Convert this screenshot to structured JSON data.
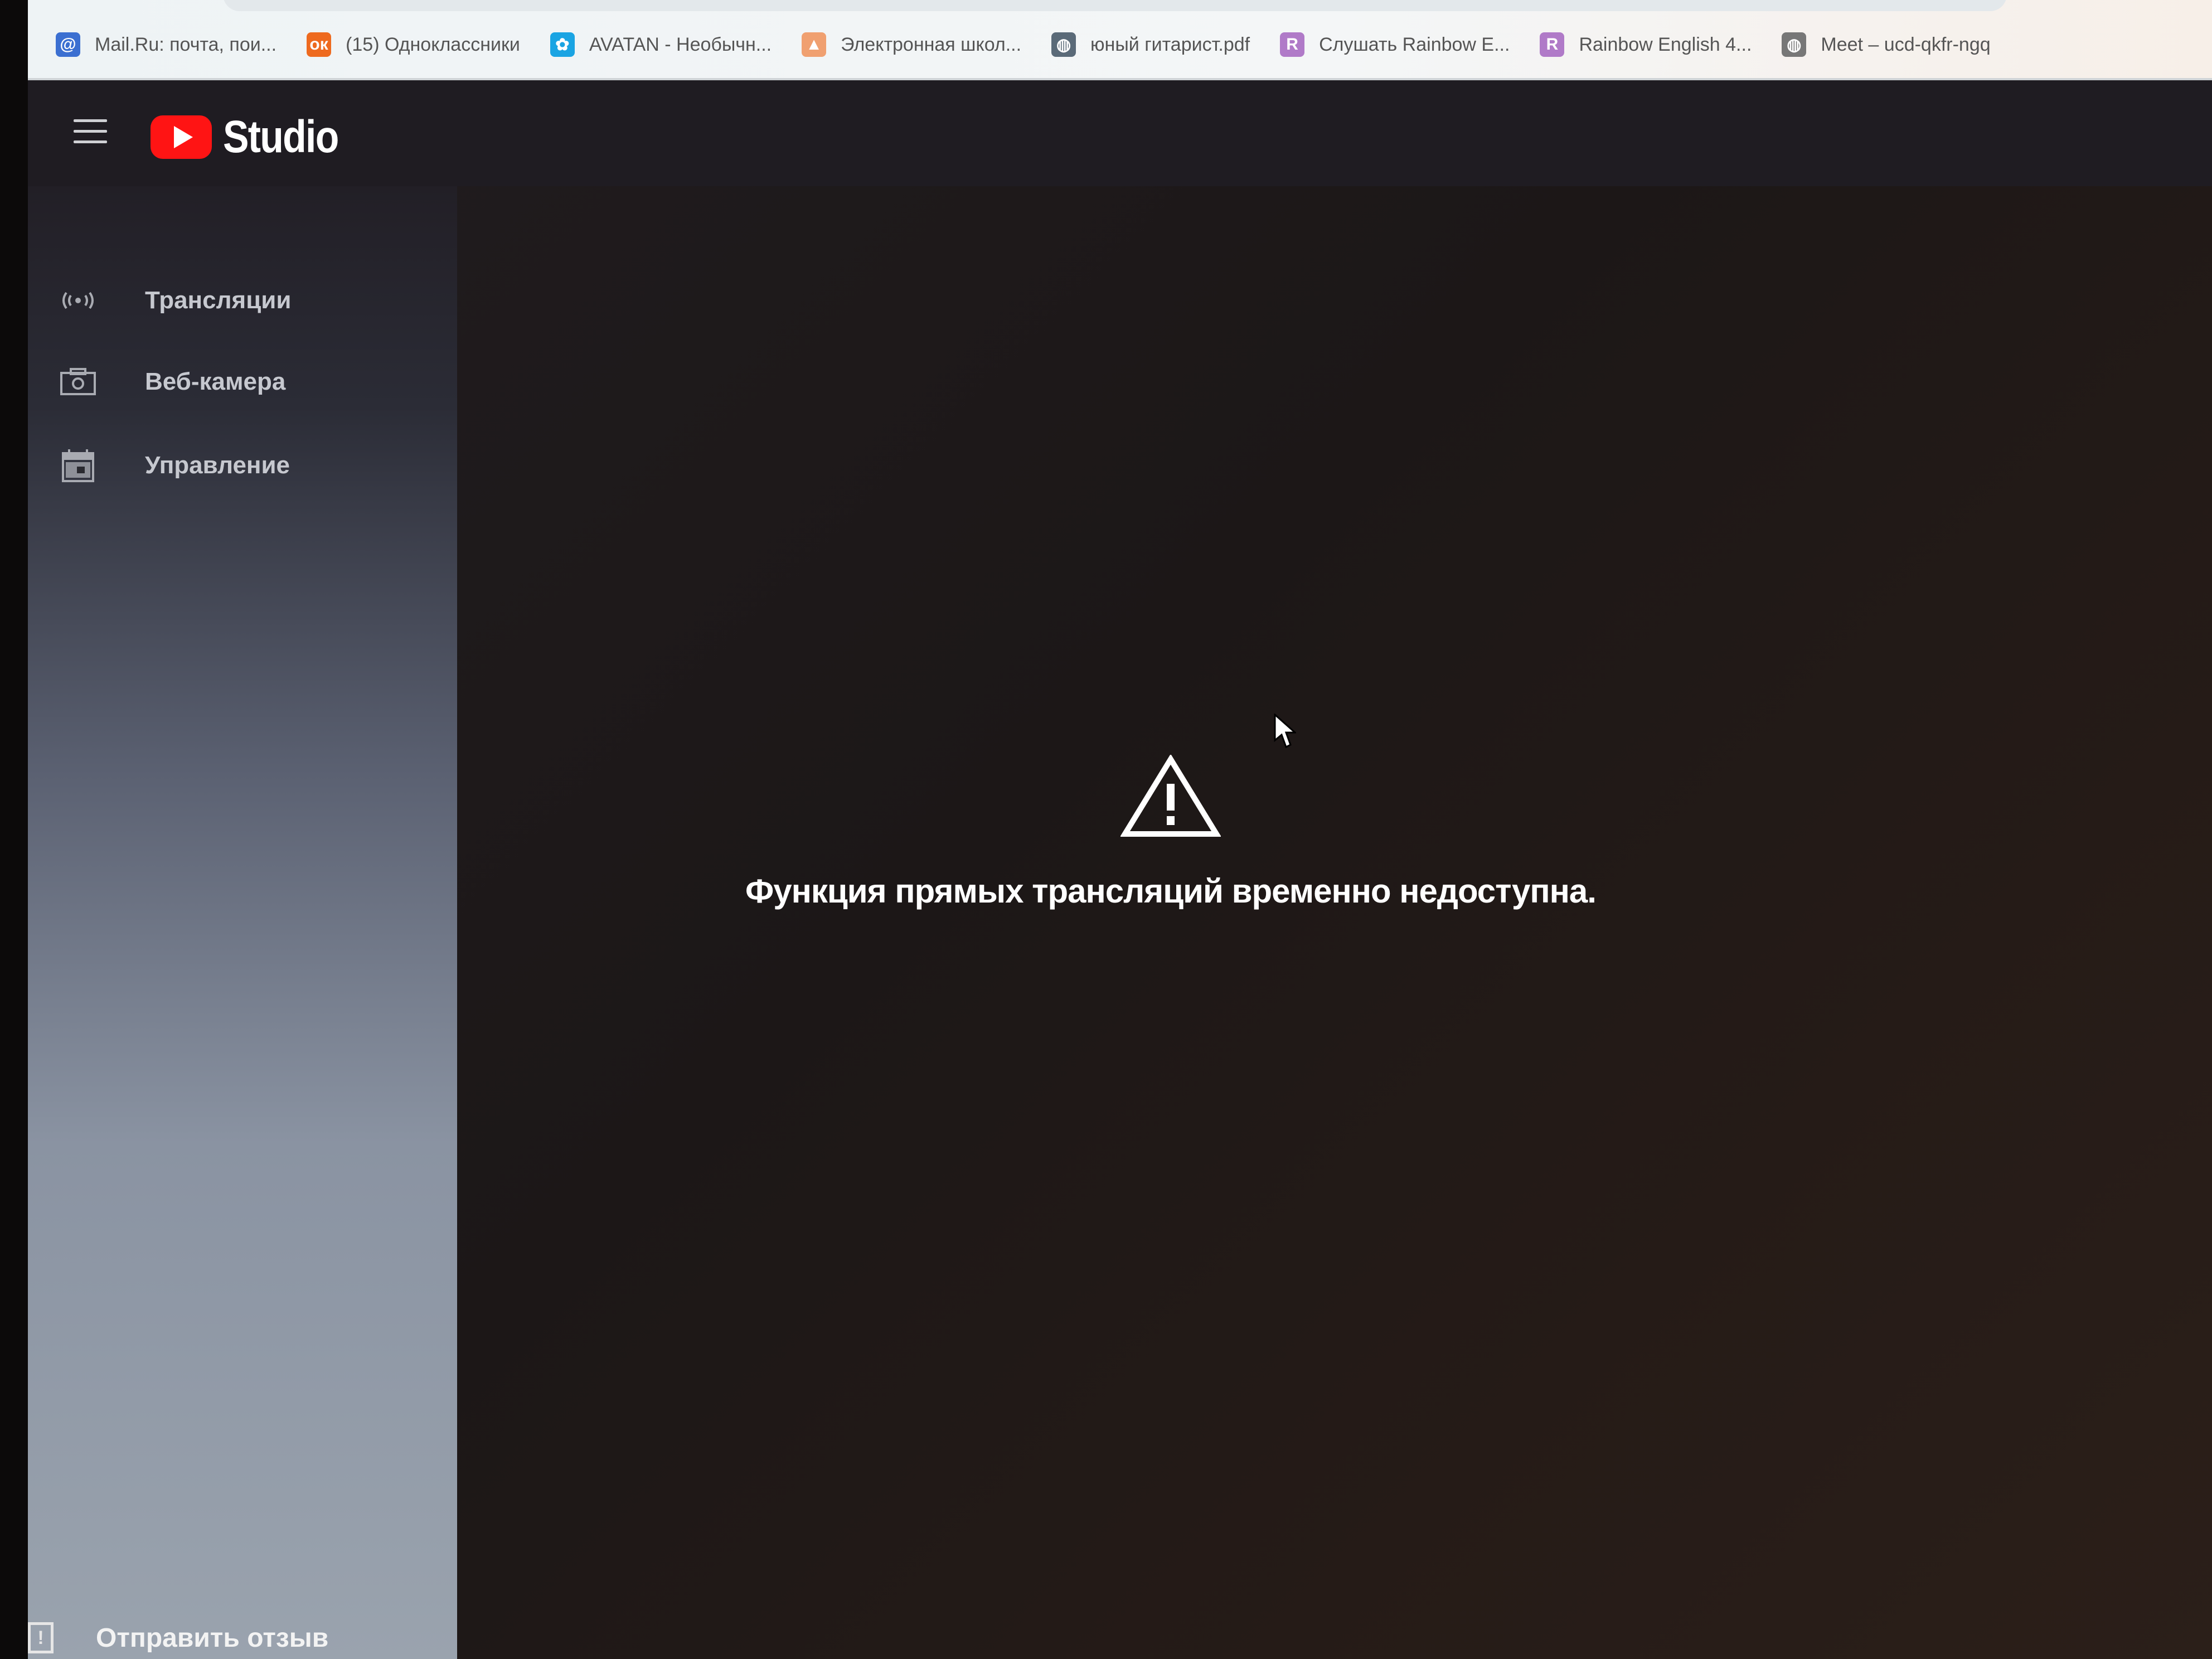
{
  "browser": {
    "bookmarks": [
      {
        "label": "Mail.Ru: почта, пои...",
        "icon": "mailru-icon",
        "color": "#3b6fd1",
        "glyph": "@"
      },
      {
        "label": "(15) Одноклассники",
        "icon": "odnoklassniki-icon",
        "color": "#ee6a1f",
        "glyph": "ок"
      },
      {
        "label": "AVATAN - Необычн...",
        "icon": "avatan-icon",
        "color": "#1aa4e3",
        "glyph": "✿"
      },
      {
        "label": "Электронная школ...",
        "icon": "school-icon",
        "color": "#f0a070",
        "glyph": "▲"
      },
      {
        "label": "юный гитарист.pdf",
        "icon": "globe-icon",
        "color": "#5a6a78",
        "glyph": "◍"
      },
      {
        "label": "Слушать Rainbow E...",
        "icon": "rainbow-icon",
        "color": "#b07ac8",
        "glyph": "R"
      },
      {
        "label": "Rainbow English 4...",
        "icon": "rainbow-icon",
        "color": "#b07ac8",
        "glyph": "R"
      },
      {
        "label": "Meet – ucd-qkfr-ngq",
        "icon": "globe-icon",
        "color": "#777777",
        "glyph": "◍"
      }
    ]
  },
  "app": {
    "logo_text": "Studio",
    "brand_color": "#ff1414",
    "sidebar": {
      "items": [
        {
          "label": "Трансляции",
          "icon": "live-broadcast-icon",
          "glyph": "((•))"
        },
        {
          "label": "Веб-камера",
          "icon": "camera-icon",
          "glyph": "📷"
        },
        {
          "label": "Управление",
          "icon": "calendar-icon",
          "glyph": "▣"
        }
      ],
      "feedback_label": "Отправить отзыв",
      "feedback_icon": "feedback-icon"
    },
    "main": {
      "message": "Функция прямых трансляций временно недоступна.",
      "message_icon": "warning-icon"
    }
  }
}
